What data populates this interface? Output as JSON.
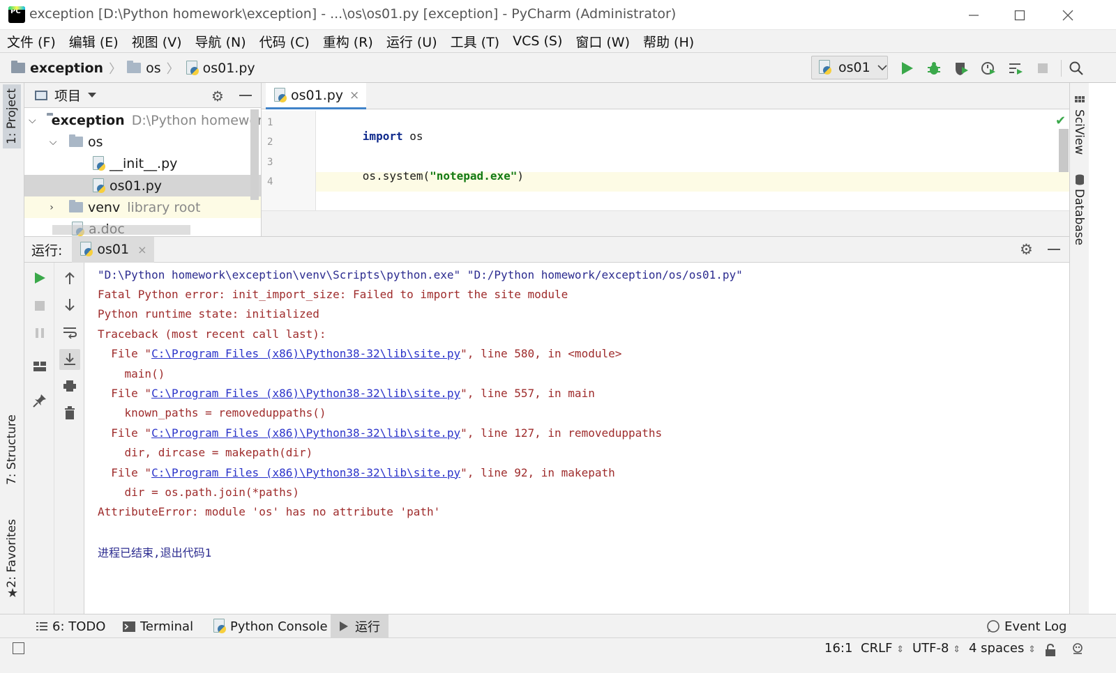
{
  "window": {
    "title": "exception [D:\\Python homework\\exception] - ...\\os\\os01.py [exception] - PyCharm (Administrator)",
    "logo_text": "PC"
  },
  "menu": [
    "文件 (F)",
    "编辑 (E)",
    "视图 (V)",
    "导航 (N)",
    "代码 (C)",
    "重构 (R)",
    "运行 (U)",
    "工具 (T)",
    "VCS (S)",
    "窗口 (W)",
    "帮助 (H)"
  ],
  "breadcrumb": {
    "project": "exception",
    "folder": "os",
    "file": "os01.py"
  },
  "run_config": {
    "selected": "os01"
  },
  "left_strip": {
    "project": "1: Project",
    "structure": "7: Structure",
    "favorites": "2: Favorites"
  },
  "right_strip": {
    "sciview": "SciView",
    "database": "Database"
  },
  "project_panel": {
    "title": "项目",
    "tree": {
      "root_name": "exception",
      "root_path": "D:\\Python homework",
      "os": "os",
      "init": "__init__.py",
      "os01": "os01.py",
      "venv": "venv",
      "venv_hint": "library root",
      "adoc": "a.doc"
    }
  },
  "editor": {
    "tab": "os01.py",
    "line_numbers": [
      "1",
      "2",
      "3",
      "4"
    ],
    "code": {
      "l1_kw": "import",
      "l1_rest": " os",
      "l3_pre": "os.system(",
      "l3_str": "\"notepad.exe\"",
      "l3_post": ")"
    }
  },
  "run": {
    "label": "运行:",
    "tab": "os01",
    "console": {
      "cmd": "\"D:\\Python homework\\exception\\venv\\Scripts\\python.exe\" \"D:/Python homework/exception/os/os01.py\"",
      "l1": "Fatal Python error: init_import_size: Failed to import the site module",
      "l2": "Python runtime state: initialized",
      "l3": "Traceback (most recent call last):",
      "file_prefix": "  File \"",
      "site_path": "C:\\Program Files (x86)\\Python38-32\\lib\\site.py",
      "t1_suffix": "\", line 580, in <module>",
      "t1_code": "    main()",
      "t2_suffix": "\", line 557, in main",
      "t2_code": "    known_paths = removeduppaths()",
      "t3_suffix": "\", line 127, in removeduppaths",
      "t3_code": "    dir, dircase = makepath(dir)",
      "t4_suffix": "\", line 92, in makepath",
      "t4_code": "    dir = os.path.join(*paths)",
      "error": "AttributeError: module 'os' has no attribute 'path'",
      "exit": "进程已结束,退出代码1"
    }
  },
  "bottom_tools": {
    "todo": "6: TODO",
    "terminal": "Terminal",
    "python_console": "Python Console",
    "run": "运行",
    "event_log": "Event Log"
  },
  "status": {
    "position": "16:1",
    "line_sep": "CRLF",
    "encoding": "UTF-8",
    "indent": "4 spaces"
  },
  "colors": {
    "accent_green": "#3aa84a",
    "link": "#2a33c9",
    "error_text": "#9e2b2b",
    "caret_line": "#fdfbe5"
  }
}
